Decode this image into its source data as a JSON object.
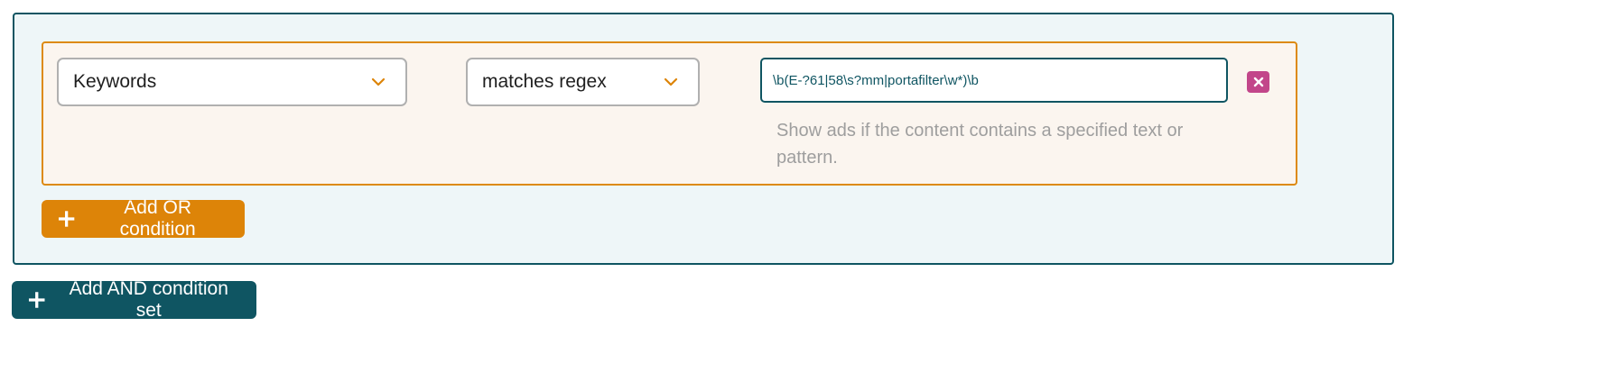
{
  "condition": {
    "type_select": {
      "value": "Keywords",
      "icon": "chevron-down-icon"
    },
    "operator_select": {
      "value": "matches regex",
      "icon": "chevron-down-icon"
    },
    "regex_input": {
      "value": "\\b(E-?61|58\\s?mm|portafilter\\w*)\\b"
    },
    "remove_button": {
      "icon": "close-icon",
      "color": "#c2468a"
    },
    "hint": "Show ads if the content contains a specified text or pattern."
  },
  "buttons": {
    "add_or": {
      "label": "Add OR condition",
      "icon": "plus-icon",
      "color": "#dd8408"
    },
    "add_and": {
      "label": "Add AND condition set",
      "icon": "plus-icon",
      "color": "#0f5562"
    }
  },
  "colors": {
    "and_border": "#0f5562",
    "and_background": "#eef6f8",
    "or_border": "#dd8a10",
    "or_background": "#fbf5ef"
  }
}
